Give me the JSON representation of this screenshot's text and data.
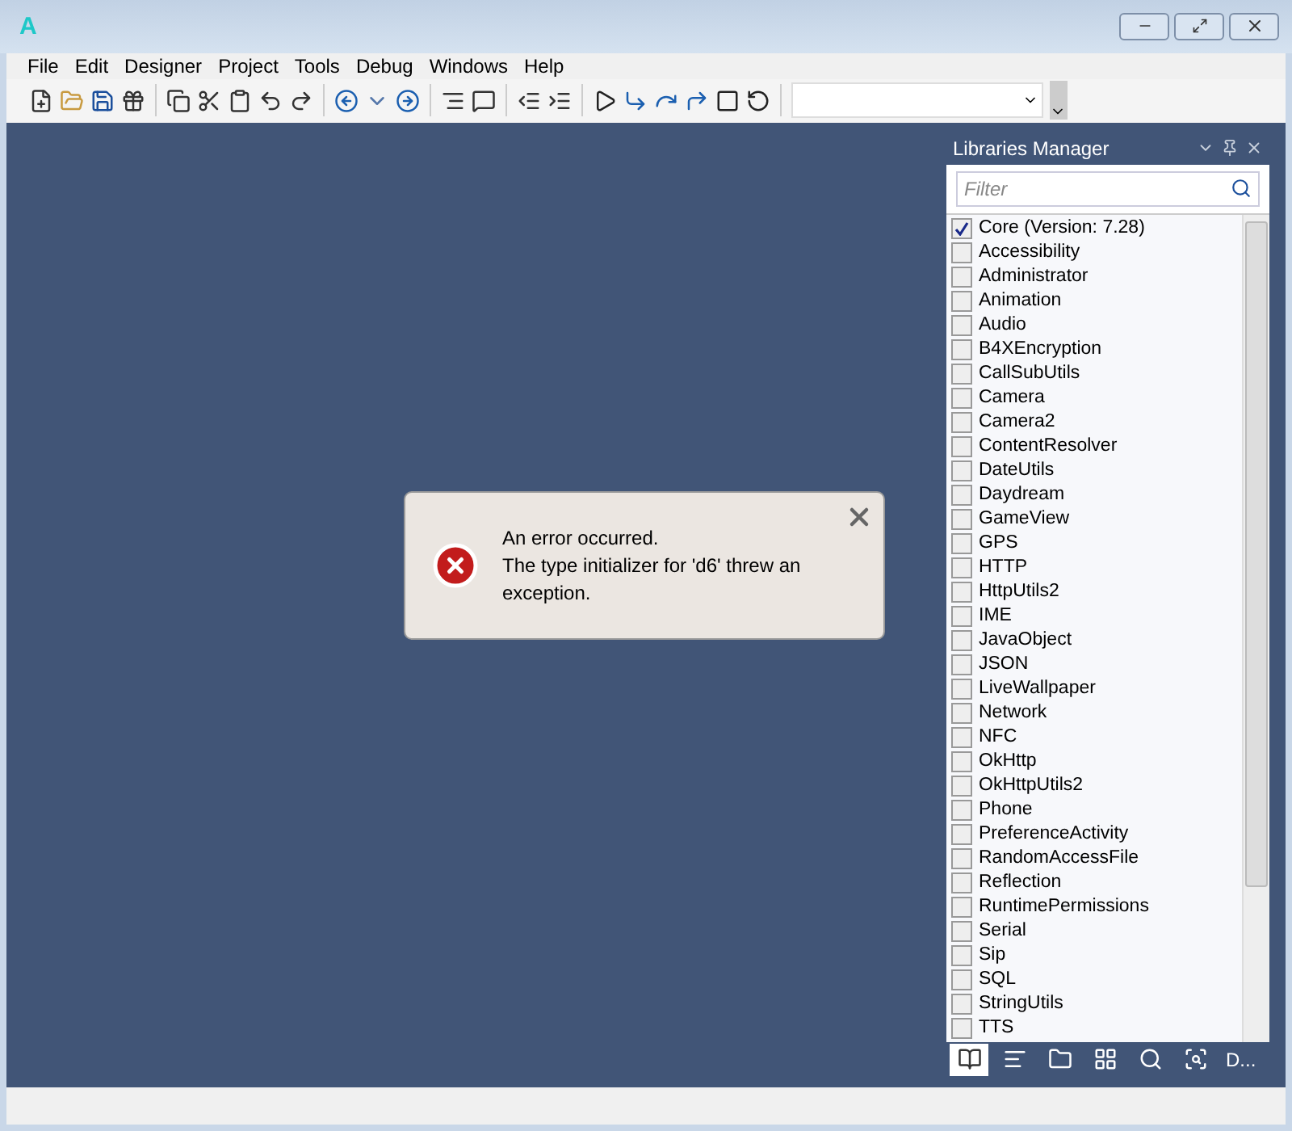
{
  "window": {
    "logo": "A"
  },
  "menu": [
    "File",
    "Edit",
    "Designer",
    "Project",
    "Tools",
    "Debug",
    "Windows",
    "Help"
  ],
  "panel": {
    "title": "Libraries Manager",
    "filter": {
      "placeholder": "Filter"
    },
    "libraries": [
      {
        "name": "Core (Version: 7.28)",
        "checked": true
      },
      {
        "name": "Accessibility",
        "checked": false
      },
      {
        "name": "Administrator",
        "checked": false
      },
      {
        "name": "Animation",
        "checked": false
      },
      {
        "name": "Audio",
        "checked": false
      },
      {
        "name": "B4XEncryption",
        "checked": false
      },
      {
        "name": "CallSubUtils",
        "checked": false
      },
      {
        "name": "Camera",
        "checked": false
      },
      {
        "name": "Camera2",
        "checked": false
      },
      {
        "name": "ContentResolver",
        "checked": false
      },
      {
        "name": "DateUtils",
        "checked": false
      },
      {
        "name": "Daydream",
        "checked": false
      },
      {
        "name": "GameView",
        "checked": false
      },
      {
        "name": "GPS",
        "checked": false
      },
      {
        "name": "HTTP",
        "checked": false
      },
      {
        "name": "HttpUtils2",
        "checked": false
      },
      {
        "name": "IME",
        "checked": false
      },
      {
        "name": "JavaObject",
        "checked": false
      },
      {
        "name": "JSON",
        "checked": false
      },
      {
        "name": "LiveWallpaper",
        "checked": false
      },
      {
        "name": "Network",
        "checked": false
      },
      {
        "name": "NFC",
        "checked": false
      },
      {
        "name": "OkHttp",
        "checked": false
      },
      {
        "name": "OkHttpUtils2",
        "checked": false
      },
      {
        "name": "Phone",
        "checked": false
      },
      {
        "name": "PreferenceActivity",
        "checked": false
      },
      {
        "name": "RandomAccessFile",
        "checked": false
      },
      {
        "name": "Reflection",
        "checked": false
      },
      {
        "name": "RuntimePermissions",
        "checked": false
      },
      {
        "name": "Serial",
        "checked": false
      },
      {
        "name": "Sip",
        "checked": false
      },
      {
        "name": "SQL",
        "checked": false
      },
      {
        "name": "StringUtils",
        "checked": false
      },
      {
        "name": "TTS",
        "checked": false
      }
    ],
    "tabs": [
      {
        "kind": "book",
        "selected": true
      },
      {
        "kind": "list",
        "selected": false
      },
      {
        "kind": "folder",
        "selected": false
      },
      {
        "kind": "layout",
        "selected": false
      },
      {
        "kind": "search",
        "selected": false
      },
      {
        "kind": "find",
        "selected": false
      },
      {
        "kind": "text",
        "label": "D...",
        "selected": false
      }
    ]
  },
  "dialog": {
    "lines": [
      "An error occurred.",
      "The type initializer for 'd6' threw an exception."
    ]
  }
}
